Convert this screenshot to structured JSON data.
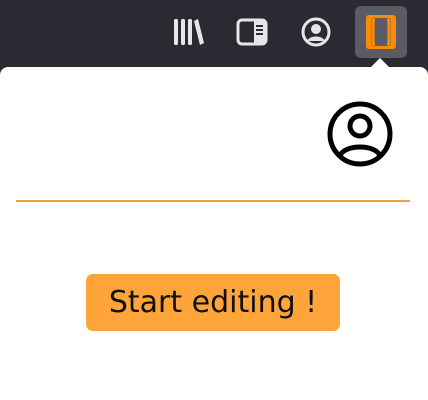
{
  "toolbar": {
    "icons": [
      "library-icon",
      "sidebar-icon",
      "account-icon",
      "extension-icon"
    ],
    "colors": {
      "background": "#2b2a33",
      "icon": "#e6e6e6",
      "active_button": "#5b5b66",
      "extension_accent": "#ff8c00"
    }
  },
  "panel": {
    "account_icon": "account-circle-icon",
    "divider_color": "#f0a040",
    "button": {
      "label": "Start editing !",
      "color": "#ffa438"
    }
  }
}
